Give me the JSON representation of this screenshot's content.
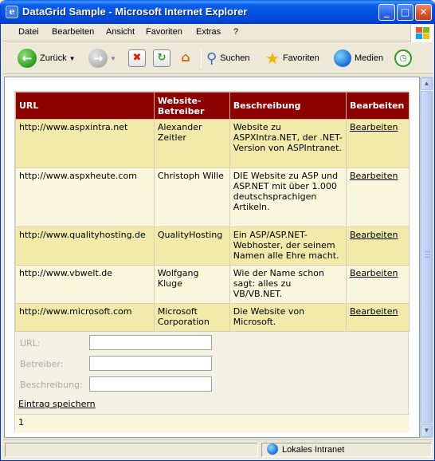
{
  "window": {
    "title": "DataGrid Sample - Microsoft Internet Explorer"
  },
  "menu": [
    "Datei",
    "Bearbeiten",
    "Ansicht",
    "Favoriten",
    "Extras",
    "?"
  ],
  "toolbar": {
    "back_label": "Zurück",
    "search_label": "Suchen",
    "favorites_label": "Favoriten",
    "media_label": "Medien"
  },
  "grid": {
    "headers": [
      "URL",
      "Website-Betreiber",
      "Beschreibung",
      "Bearbeiten"
    ],
    "rows": [
      {
        "url": "http://www.aspxintra.net",
        "operator": "Alexander Zeitler",
        "description": "Website zu ASPXIntra.NET, der .NET-Version von ASPIntranet.",
        "edit": "Bearbeiten"
      },
      {
        "url": "http://www.aspxheute.com",
        "operator": "Christoph Wille",
        "description": "DIE Website zu ASP und ASP.NET mit über 1.000 deutschsprachigen Artikeln.",
        "edit": "Bearbeiten"
      },
      {
        "url": "http://www.qualityhosting.de",
        "operator": "QualityHosting",
        "description": "Ein ASP/ASP.NET-Webhoster, der seinem Namen alle Ehre macht.",
        "edit": "Bearbeiten"
      },
      {
        "url": "http://www.vbwelt.de",
        "operator": "Wolfgang Kluge",
        "description": "Wie der Name schon sagt: alles zu VB/VB.NET.",
        "edit": "Bearbeiten"
      },
      {
        "url": "http://www.microsoft.com",
        "operator": "Microsoft Corporation",
        "description": "Die Website von Microsoft.",
        "edit": "Bearbeiten"
      }
    ]
  },
  "form": {
    "url_label": "URL:",
    "operator_label": "Betreiber:",
    "description_label": "Beschreibung:",
    "url_value": "",
    "operator_value": "",
    "description_value": "",
    "save_label": "Eintrag speichern"
  },
  "pager": {
    "page": "1"
  },
  "status": {
    "zone": "Lokales Intranet"
  },
  "colors": {
    "header_bg": "#8c0000",
    "row_odd": "#f1eaaa",
    "row_even": "#fbf7dd",
    "titlebar": "#0054e3"
  },
  "icons": [
    "ie-icon",
    "minimize-icon",
    "maximize-icon",
    "close-icon",
    "windows-flag-icon",
    "back-arrow-icon",
    "forward-arrow-icon",
    "stop-icon",
    "refresh-icon",
    "home-icon",
    "search-icon",
    "favorites-star-icon",
    "media-icon",
    "history-icon",
    "intranet-globe-icon"
  ]
}
